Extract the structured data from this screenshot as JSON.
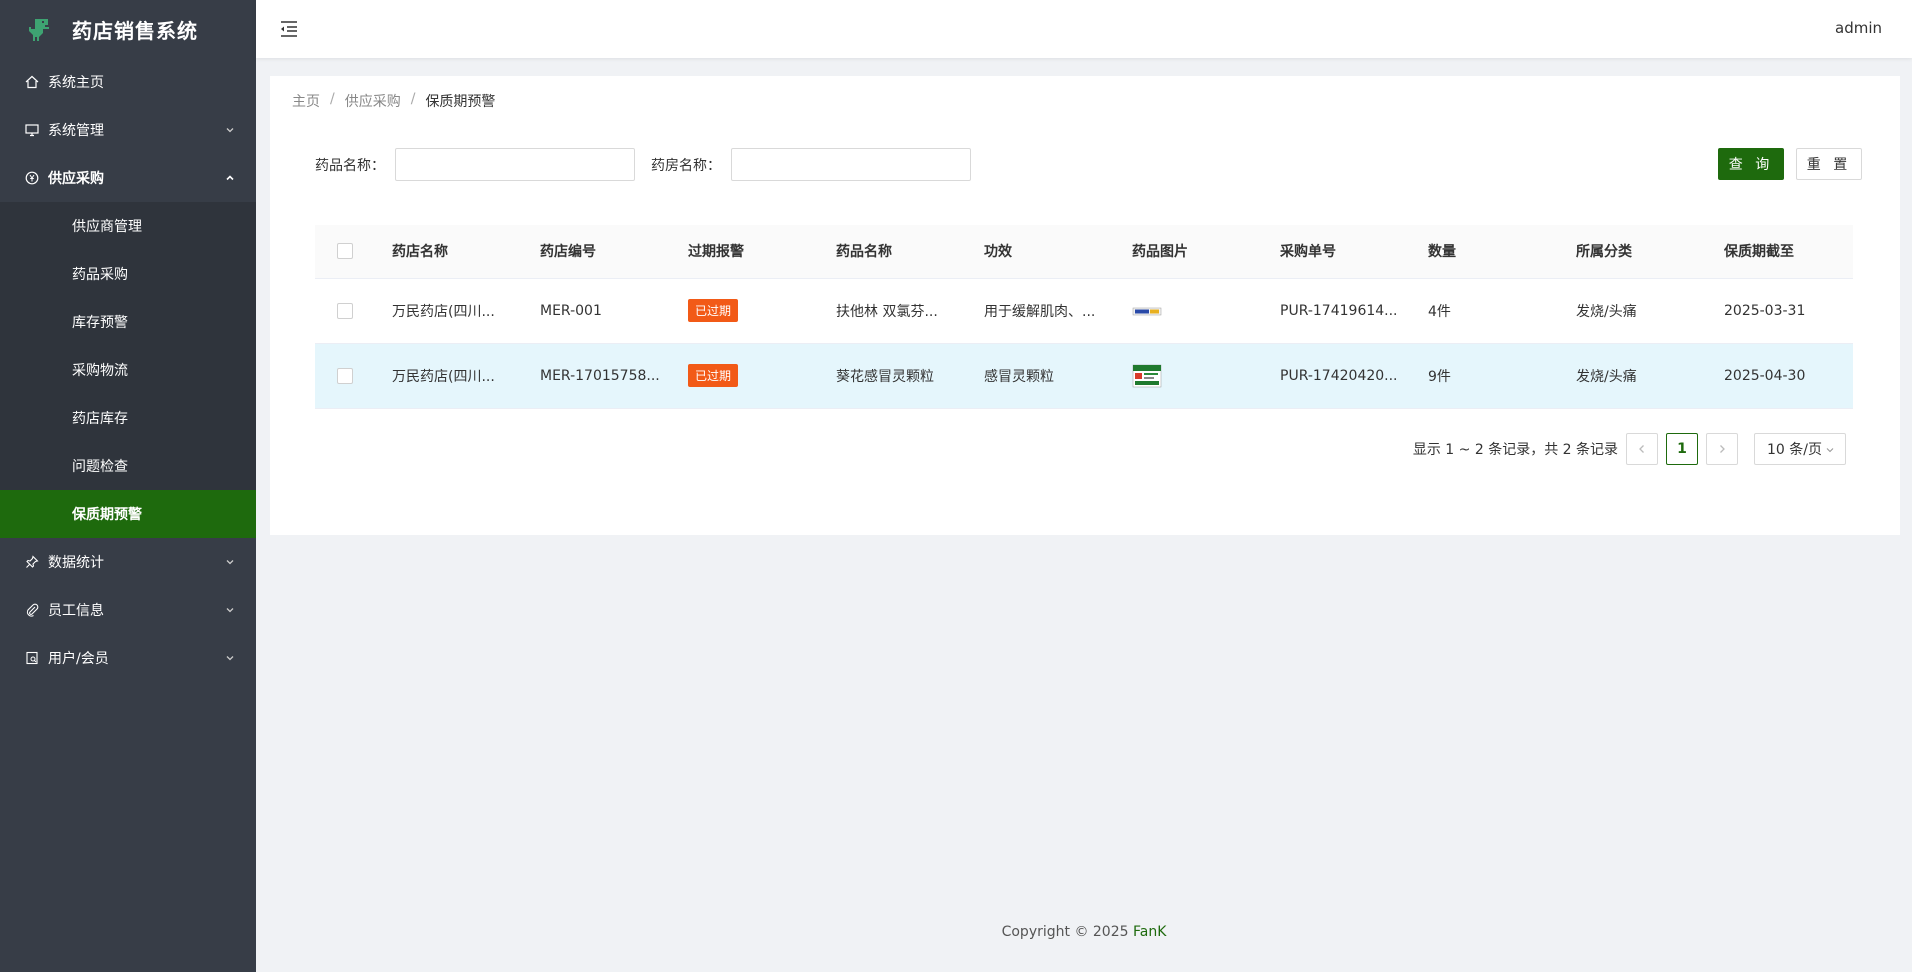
{
  "app": {
    "title": "药店销售系统",
    "user": "admin"
  },
  "sidebar": {
    "items": [
      {
        "label": "系统主页"
      },
      {
        "label": "系统管理"
      },
      {
        "label": "供应采购"
      },
      {
        "label": "数据统计"
      },
      {
        "label": "员工信息"
      },
      {
        "label": "用户/会员"
      }
    ],
    "submenu": [
      {
        "label": "供应商管理"
      },
      {
        "label": "药品采购"
      },
      {
        "label": "库存预警"
      },
      {
        "label": "采购物流"
      },
      {
        "label": "药店库存"
      },
      {
        "label": "问题检查"
      },
      {
        "label": "保质期预警"
      }
    ]
  },
  "breadcrumb": {
    "home": "主页",
    "parent": "供应采购",
    "current": "保质期预警",
    "sep": "/"
  },
  "search": {
    "drug_label": "药品名称：",
    "pharmacy_label": "药房名称：",
    "query_btn": "查 询",
    "reset_btn": "重 置"
  },
  "table": {
    "headers": [
      "药店名称",
      "药店编号",
      "过期报警",
      "药品名称",
      "功效",
      "药品图片",
      "采购单号",
      "数量",
      "所属分类",
      "保质期截至"
    ],
    "rows": [
      {
        "store": "万民药店(四川...",
        "code": "MER-001",
        "alarm": "已过期",
        "drug": "扶他林 双氯芬...",
        "effect": "用于缓解肌肉、...",
        "order": "PUR-17419614...",
        "qty": "4件",
        "category": "发烧/头痛",
        "expire": "2025-03-31"
      },
      {
        "store": "万民药店(四川...",
        "code": "MER-17015758...",
        "alarm": "已过期",
        "drug": "葵花感冒灵颗粒",
        "effect": "感冒灵颗粒",
        "order": "PUR-17420420...",
        "qty": "9件",
        "category": "发烧/头痛",
        "expire": "2025-04-30"
      }
    ]
  },
  "pager": {
    "summary": "显示 1 ~ 2 条记录，共 2 条记录",
    "page": "1",
    "size": "10 条/页"
  },
  "footer": {
    "prefix": "Copyright © 2025 ",
    "brand": "FanK"
  },
  "colors": {
    "accent": "#1e6a0d",
    "sidebar": "#373d47",
    "badge": "#f25a17",
    "highlight": "#e5f6fc"
  }
}
